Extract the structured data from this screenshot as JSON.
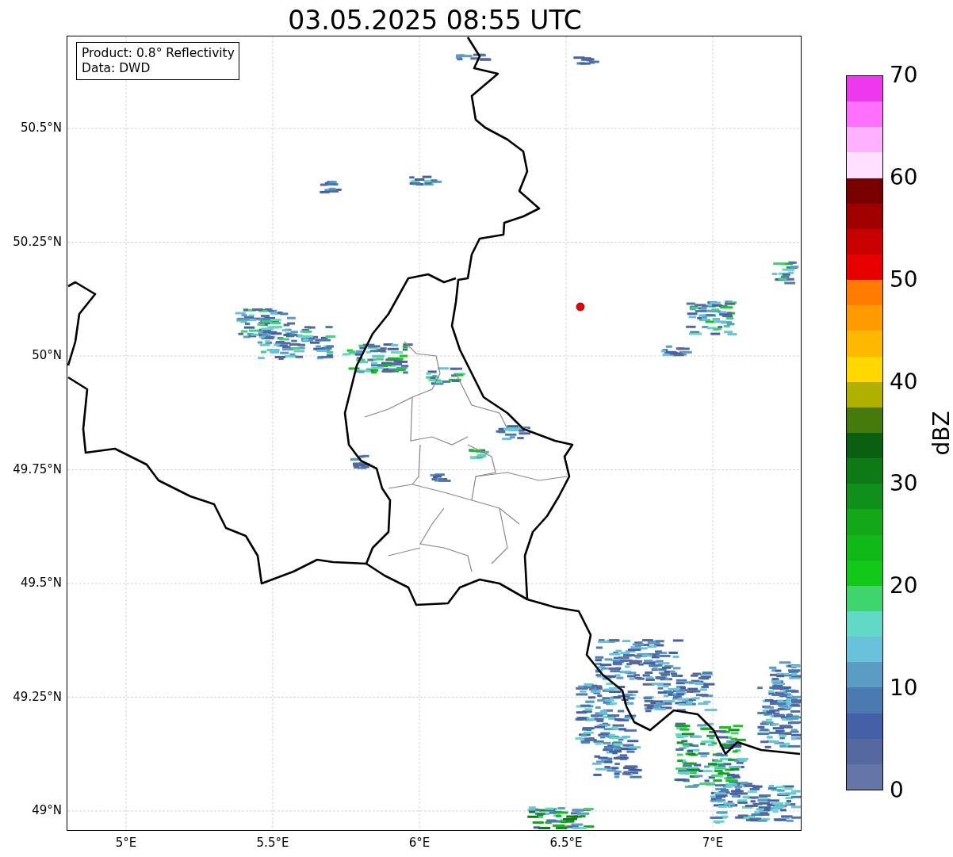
{
  "title": "03.05.2025 08:55 UTC",
  "legend": [
    "Product: 0.8° Reflectivity",
    "Data: DWD"
  ],
  "map": {
    "lat_ticks": [
      "50.5°N",
      "50.25°N",
      "50°N",
      "49.75°N",
      "49.5°N",
      "49.25°N",
      "49°N"
    ],
    "lon_ticks": [
      "5°E",
      "5.5°E",
      "6°E",
      "6.5°E",
      "7°E"
    ]
  },
  "colorbar": {
    "label": "dBZ",
    "ticks": [
      "70",
      "60",
      "50",
      "40",
      "30",
      "20",
      "10",
      "0"
    ],
    "bands": [
      {
        "color": "#6675a8"
      },
      {
        "color": "#5568a0"
      },
      {
        "color": "#4460a6"
      },
      {
        "color": "#4a7ab0"
      },
      {
        "color": "#5a9cc4"
      },
      {
        "color": "#68c2dc"
      },
      {
        "color": "#62d8c6"
      },
      {
        "color": "#3ed46e"
      },
      {
        "color": "#12c818"
      },
      {
        "color": "#10b818"
      },
      {
        "color": "#12a818"
      },
      {
        "color": "#0f901a"
      },
      {
        "color": "#0d7a16"
      },
      {
        "color": "#0a6010"
      },
      {
        "color": "#467a0c"
      },
      {
        "color": "#b0b000"
      },
      {
        "color": "#ffd800"
      },
      {
        "color": "#ffb800"
      },
      {
        "color": "#ff9a00"
      },
      {
        "color": "#ff7c00"
      },
      {
        "color": "#e80000"
      },
      {
        "color": "#c80000"
      },
      {
        "color": "#a00000"
      },
      {
        "color": "#780000"
      },
      {
        "color": "#ffe0ff"
      },
      {
        "color": "#ffb0ff"
      },
      {
        "color": "#ff70ff"
      },
      {
        "color": "#ee38ee"
      }
    ]
  }
}
